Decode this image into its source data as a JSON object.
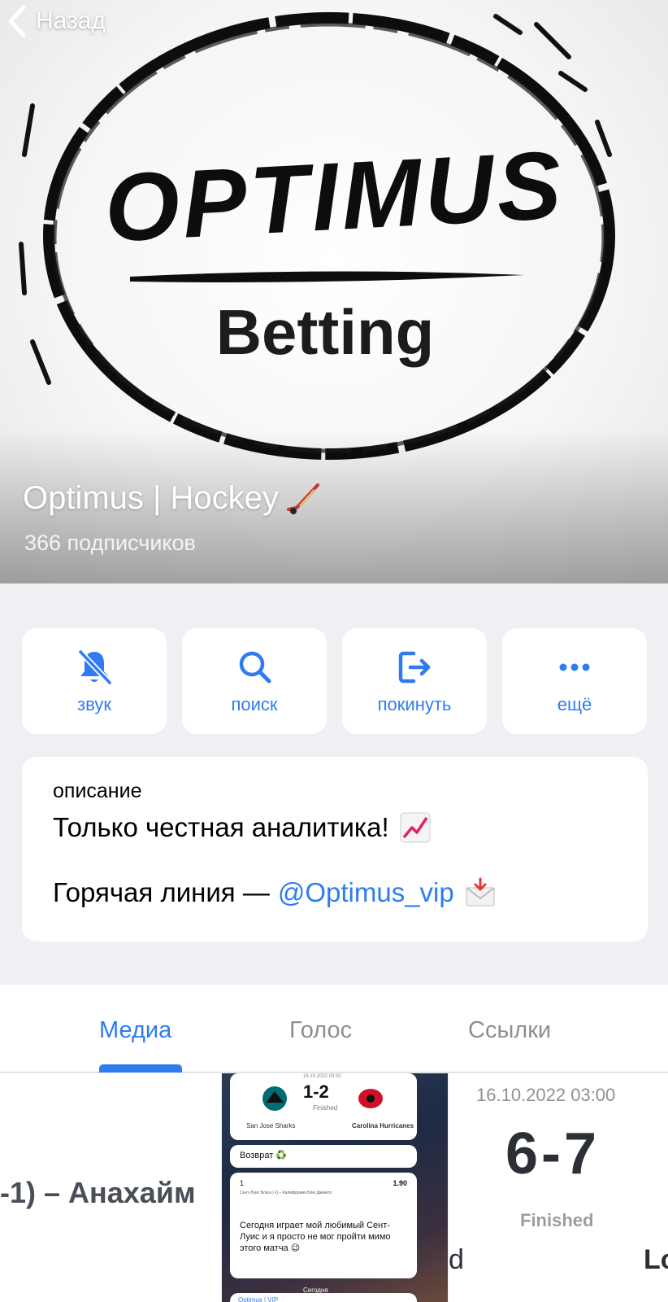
{
  "header": {
    "back_label": "Назад",
    "channel_title": "Optimus | Hockey",
    "subscribers": "366 подписчиков",
    "logo": {
      "main_text": "OPTIMUS",
      "sub_text": "Betting"
    }
  },
  "actions": [
    {
      "label": "звук",
      "icon": "bell-muted-icon"
    },
    {
      "label": "поиск",
      "icon": "search-icon"
    },
    {
      "label": "покинуть",
      "icon": "leave-icon"
    },
    {
      "label": "ещё",
      "icon": "more-icon"
    }
  ],
  "description": {
    "caption": "описание",
    "line1": "Только честная аналитика!",
    "line2_prefix": "Горячая линия —",
    "line2_link": "@Optimus_vip"
  },
  "tabs": [
    {
      "label": "Медиа",
      "active": true
    },
    {
      "label": "Голос",
      "active": false
    },
    {
      "label": "Ссылки",
      "active": false
    }
  ],
  "media": {
    "item1": {
      "text": "-1) – Анахайм"
    },
    "item2": {
      "date": "16.10.2022 03:30",
      "score": "1-2",
      "status": "Finished",
      "team_left": "San Jose Sharks",
      "team_right": "Carolina Hurricanes",
      "vozvrat": "Возврат ♻️",
      "msg_num": "1",
      "msg_odds": "1.90",
      "msg_small": "Сент-Луис Блюз (-1) – Калифорния Блю Джекетс",
      "msg_body": "Сегодня играет мой любимый Сент-Луис и я просто не мог пройти мимо этого матча 😉",
      "today": "Сегодня",
      "bottom": "Optimus | VIP"
    },
    "item3": {
      "date": "16.10.2022 03:00",
      "score": "6-7",
      "status": "Finished",
      "left": "d",
      "right": "Lo"
    }
  },
  "colors": {
    "accent": "#2f7cf0",
    "background": "#efeff4",
    "card": "#ffffff"
  }
}
